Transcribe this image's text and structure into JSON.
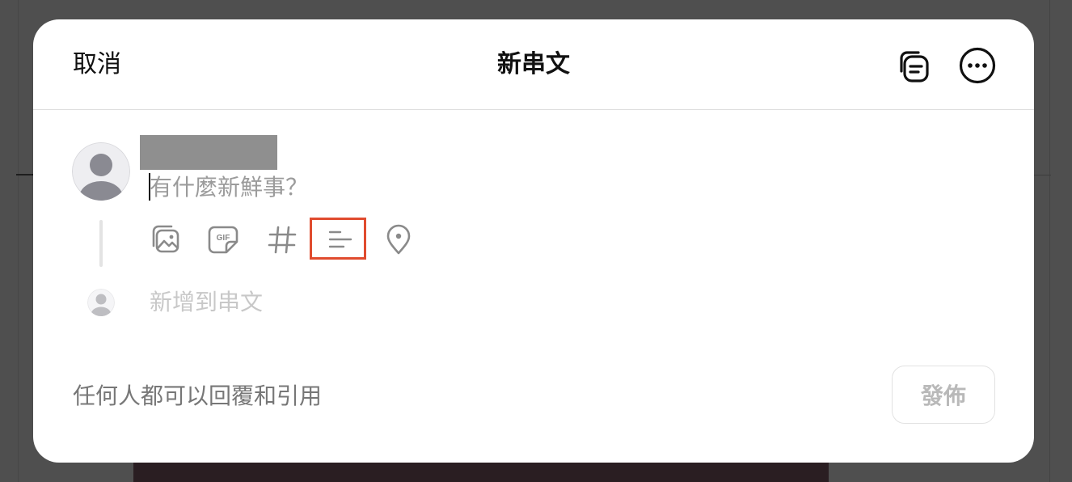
{
  "header": {
    "cancel_label": "取消",
    "title": "新串文",
    "drafts_icon": "drafts-icon",
    "more_icon": "more-icon"
  },
  "composer": {
    "placeholder": "有什麼新鮮事？",
    "toolbar": {
      "items": [
        {
          "icon": "image-icon"
        },
        {
          "icon": "gif-icon"
        },
        {
          "icon": "hashtag-icon"
        },
        {
          "icon": "poll-icon",
          "highlighted": true
        },
        {
          "icon": "location-icon"
        }
      ]
    },
    "add_to_thread": "新增到串文"
  },
  "footer": {
    "reply_setting": "任何人都可以回覆和引用",
    "post_label": "發佈"
  },
  "colors": {
    "highlight": "#e04b2e",
    "backdrop": "#4f4f4f"
  }
}
